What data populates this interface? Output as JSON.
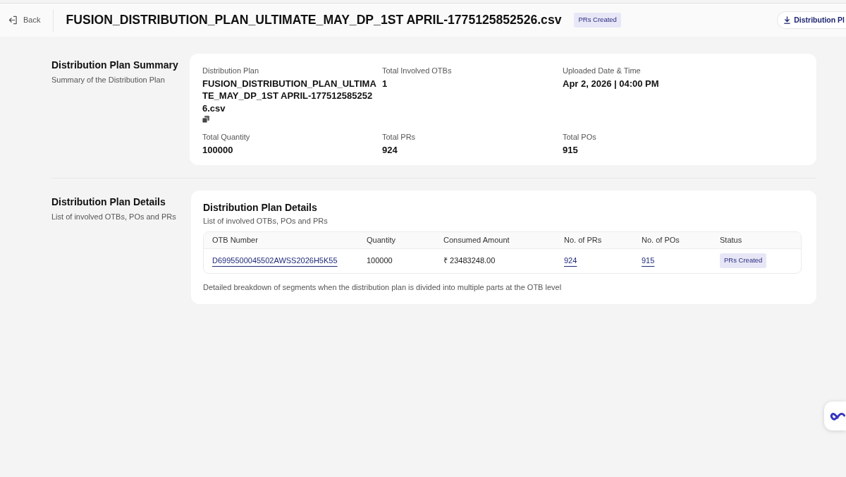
{
  "header": {
    "back": {
      "label": "Back"
    },
    "title": "FUSION_DISTRIBUTION_PLAN_ULTIMATE_MAY_DP_1ST APRIL-1775125852526.csv",
    "status_badge": "PRs Created",
    "download_button": {
      "label": "Distribution Pl"
    }
  },
  "summary_section": {
    "title": "Distribution Plan Summary",
    "subtitle": "Summary of the Distribution Plan",
    "fields": [
      {
        "label": "Distribution Plan",
        "value": "FUSION_DISTRIBUTION_PLAN_ULTIMATE_MAY_DP_1ST APRIL-1775125852526.csv",
        "copyable": true
      },
      {
        "label": "Total Involved OTBs",
        "value": "1",
        "copyable": false
      },
      {
        "label": "Uploaded Date & Time",
        "value": "Apr 2, 2026 | 04:00 PM",
        "copyable": false
      },
      {
        "label": "Total Quantity",
        "value": "100000",
        "copyable": false
      },
      {
        "label": "Total PRs",
        "value": "924",
        "copyable": false
      },
      {
        "label": "Total POs",
        "value": "915",
        "copyable": false
      }
    ]
  },
  "details_section": {
    "title": "Distribution Plan Details",
    "subtitle": "List of involved OTBs, POs and PRs",
    "card": {
      "title": "Distribution Plan Details",
      "subtitle": "List of involved OTBs, POs and PRs",
      "table": {
        "columns": [
          "OTB Number",
          "Quantity",
          "Consumed Amount",
          "No. of PRs",
          "No. of POs",
          "Status"
        ],
        "rows": [
          {
            "cells": [
              {
                "kind": "link",
                "text": "D6995500045502AWSS2026H5K55"
              },
              {
                "kind": "text",
                "text": "100000"
              },
              {
                "kind": "text",
                "text": "₹ 23483248.00"
              },
              {
                "kind": "link",
                "text": "924"
              },
              {
                "kind": "link",
                "text": "915"
              },
              {
                "kind": "badge",
                "text": "PRs Created"
              }
            ]
          }
        ]
      },
      "note": "Detailed breakdown of segments when the distribution plan is divided into multiple parts at the OTB level"
    }
  }
}
